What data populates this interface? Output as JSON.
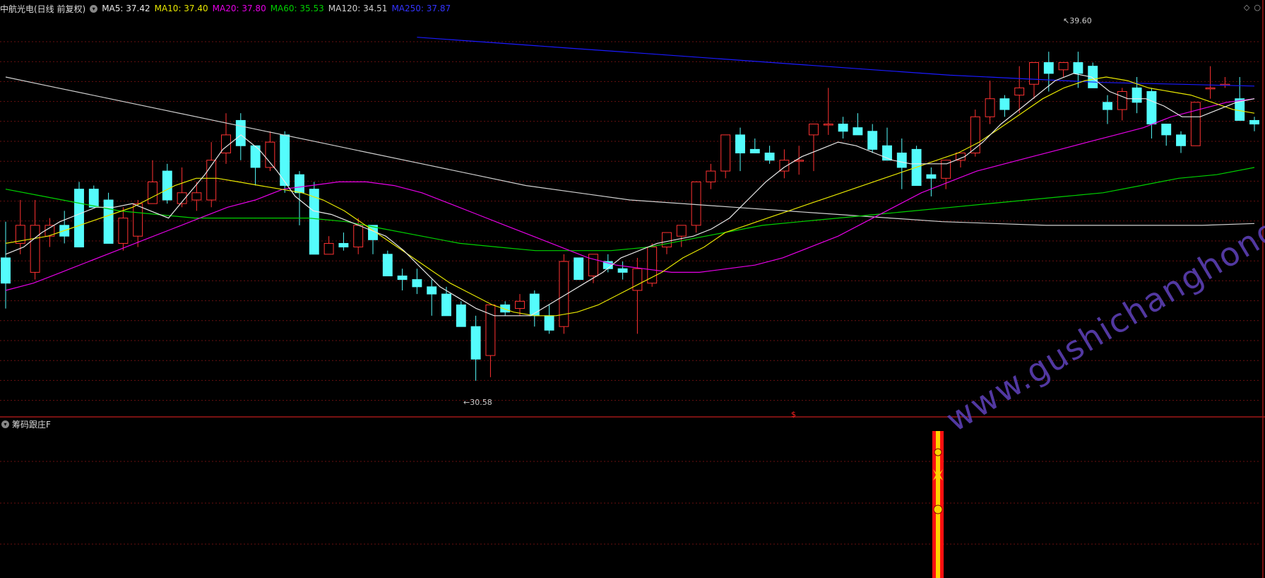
{
  "header": {
    "stock": "中航光电(日线 前复权)",
    "ma5": "MA5: 37.42",
    "ma10": "MA10: 37.40",
    "ma20": "MA20: 37.80",
    "ma60": "MA60: 35.53",
    "ma120": "MA120: 34.51",
    "ma250": "MA250: 37.87"
  },
  "colors": {
    "ma5": "#e8e8e8",
    "ma10": "#e6e600",
    "ma20": "#e600e6",
    "ma60": "#00d000",
    "ma120": "#d0d0d0",
    "ma250": "#1a1aff",
    "up": "#ff3232",
    "down": "#54fcfc"
  },
  "annotations": {
    "high": "39.60",
    "low": "30.58"
  },
  "indicator": {
    "name": "筹码跟庄F"
  },
  "marker": "$",
  "watermark": "www.gushichanghong.com",
  "topright_icons": [
    "diamond-icon",
    "circle-icon"
  ],
  "chart_data": {
    "type": "candlestick",
    "price_range": [
      29.6,
      40.6
    ],
    "candles": [
      [
        33.9,
        34.9,
        32.5,
        33.2
      ],
      [
        34.3,
        35.5,
        34.0,
        34.8
      ],
      [
        33.5,
        35.5,
        33.3,
        34.8
      ],
      [
        34.5,
        35.0,
        34.2,
        34.8
      ],
      [
        34.8,
        35.2,
        34.3,
        34.5
      ],
      [
        35.8,
        36.0,
        34.2,
        34.2
      ],
      [
        35.8,
        35.9,
        35.3,
        35.3
      ],
      [
        35.5,
        35.7,
        34.3,
        34.3
      ],
      [
        34.3,
        35.3,
        34.1,
        35.0
      ],
      [
        34.5,
        35.5,
        34.2,
        35.4
      ],
      [
        35.4,
        36.6,
        35.4,
        36.0
      ],
      [
        36.3,
        36.5,
        35.4,
        35.5
      ],
      [
        35.4,
        36.4,
        35.3,
        35.7
      ],
      [
        35.5,
        36.0,
        35.2,
        35.7
      ],
      [
        35.5,
        37.1,
        35.3,
        36.6
      ],
      [
        36.8,
        37.9,
        36.5,
        37.3
      ],
      [
        37.7,
        37.9,
        36.6,
        37.0
      ],
      [
        37.0,
        37.0,
        35.9,
        36.4
      ],
      [
        36.4,
        37.4,
        36.3,
        37.1
      ],
      [
        37.3,
        37.4,
        35.7,
        35.9
      ],
      [
        36.2,
        36.3,
        34.8,
        35.7
      ],
      [
        35.8,
        36.0,
        34.0,
        34.0
      ],
      [
        34.0,
        34.5,
        34.0,
        34.3
      ],
      [
        34.3,
        34.6,
        34.1,
        34.2
      ],
      [
        34.2,
        35.0,
        34.0,
        34.8
      ],
      [
        34.8,
        34.8,
        34.0,
        34.4
      ],
      [
        34.0,
        34.1,
        33.4,
        33.4
      ],
      [
        33.4,
        33.6,
        33.0,
        33.3
      ],
      [
        33.3,
        33.6,
        32.9,
        33.1
      ],
      [
        33.1,
        33.3,
        32.3,
        32.9
      ],
      [
        32.9,
        33.1,
        32.3,
        32.3
      ],
      [
        32.6,
        32.7,
        32.0,
        32.0
      ],
      [
        32.0,
        32.3,
        30.5,
        31.1
      ],
      [
        31.2,
        32.6,
        30.6,
        32.6
      ],
      [
        32.6,
        32.7,
        32.3,
        32.4
      ],
      [
        32.5,
        32.9,
        32.3,
        32.7
      ],
      [
        32.9,
        33.0,
        32.0,
        32.3
      ],
      [
        32.3,
        32.6,
        31.8,
        31.9
      ],
      [
        32.0,
        34.0,
        31.8,
        33.8
      ],
      [
        33.9,
        33.9,
        33.3,
        33.3
      ],
      [
        33.4,
        34.0,
        33.2,
        34.0
      ],
      [
        33.8,
        34.0,
        33.5,
        33.6
      ],
      [
        33.6,
        33.8,
        33.3,
        33.5
      ],
      [
        33.0,
        33.9,
        31.8,
        33.6
      ],
      [
        33.2,
        34.3,
        33.1,
        34.2
      ],
      [
        34.2,
        34.6,
        34.0,
        34.6
      ],
      [
        34.5,
        34.8,
        34.2,
        34.8
      ],
      [
        34.8,
        36.0,
        34.6,
        36.0
      ],
      [
        36.0,
        36.5,
        35.8,
        36.3
      ],
      [
        36.3,
        37.3,
        36.1,
        37.3
      ],
      [
        37.3,
        37.5,
        36.3,
        36.8
      ],
      [
        36.9,
        37.2,
        36.8,
        36.8
      ],
      [
        36.8,
        37.0,
        36.5,
        36.6
      ],
      [
        36.3,
        36.9,
        36.1,
        36.6
      ],
      [
        36.6,
        37.0,
        36.2,
        36.6
      ],
      [
        37.3,
        37.6,
        36.3,
        37.6
      ],
      [
        37.6,
        38.6,
        37.3,
        37.6
      ],
      [
        37.6,
        37.8,
        37.2,
        37.4
      ],
      [
        37.5,
        37.9,
        37.4,
        37.3
      ],
      [
        37.4,
        37.6,
        36.8,
        36.9
      ],
      [
        37.0,
        37.5,
        36.6,
        36.6
      ],
      [
        36.8,
        37.2,
        35.8,
        36.4
      ],
      [
        36.9,
        37.0,
        35.9,
        35.9
      ],
      [
        36.2,
        36.4,
        35.6,
        36.1
      ],
      [
        36.1,
        36.6,
        35.8,
        36.6
      ],
      [
        36.6,
        36.8,
        36.4,
        36.8
      ],
      [
        36.8,
        38.0,
        36.7,
        37.8
      ],
      [
        37.8,
        38.8,
        37.6,
        38.3
      ],
      [
        38.3,
        38.4,
        37.8,
        38.0
      ],
      [
        38.4,
        39.2,
        37.9,
        38.6
      ],
      [
        38.7,
        39.2,
        38.3,
        39.3
      ],
      [
        39.3,
        39.6,
        38.5,
        39.0
      ],
      [
        39.1,
        39.3,
        38.9,
        39.3
      ],
      [
        39.3,
        39.6,
        38.6,
        39.0
      ],
      [
        39.2,
        39.3,
        38.7,
        38.6
      ],
      [
        38.2,
        38.4,
        37.6,
        38.0
      ],
      [
        38.0,
        38.6,
        37.7,
        38.5
      ],
      [
        38.6,
        38.9,
        37.9,
        38.2
      ],
      [
        38.5,
        38.6,
        37.2,
        37.6
      ],
      [
        37.6,
        37.6,
        37.0,
        37.3
      ],
      [
        37.3,
        37.4,
        36.8,
        37.0
      ],
      [
        37.0,
        38.0,
        37.0,
        38.2
      ],
      [
        38.6,
        39.2,
        38.3,
        38.6
      ],
      [
        38.7,
        38.9,
        38.6,
        38.7
      ],
      [
        38.3,
        38.9,
        37.9,
        37.7
      ],
      [
        37.7,
        37.8,
        37.4,
        37.6
      ]
    ],
    "ma5": [
      34.0,
      34.2,
      34.6,
      34.9,
      35.1,
      35.3,
      35.3,
      35.4,
      35.2,
      35.0,
      35.6,
      36.2,
      36.9,
      37.3,
      36.9,
      36.3,
      35.6,
      35.2,
      35.1,
      34.9,
      34.7,
      34.5,
      34.1,
      33.6,
      33.1,
      32.8,
      32.5,
      32.3,
      32.3,
      32.3,
      32.6,
      32.9,
      33.2,
      33.5,
      33.9,
      34.1,
      34.3,
      34.4,
      34.5,
      34.7,
      35.0,
      35.5,
      36.0,
      36.4,
      36.7,
      36.9,
      37.1,
      37.0,
      36.8,
      36.6,
      36.5,
      36.5,
      36.5,
      36.7,
      37.1,
      37.6,
      38.0,
      38.4,
      38.8,
      39.0,
      38.9,
      38.5,
      38.3,
      38.3,
      38.1,
      37.8,
      37.8,
      38.0,
      38.2,
      38.3
    ],
    "ma10": [
      34.3,
      34.4,
      34.5,
      34.7,
      34.9,
      35.1,
      35.3,
      35.6,
      35.9,
      36.1,
      36.1,
      36.0,
      35.9,
      35.8,
      35.7,
      35.5,
      35.2,
      34.8,
      34.4,
      34.0,
      33.6,
      33.2,
      32.9,
      32.6,
      32.4,
      32.3,
      32.3,
      32.4,
      32.6,
      32.9,
      33.2,
      33.5,
      33.9,
      34.2,
      34.6,
      34.8,
      35.0,
      35.2,
      35.4,
      35.6,
      35.8,
      36.0,
      36.2,
      36.4,
      36.6,
      36.8,
      37.1,
      37.5,
      37.9,
      38.3,
      38.6,
      38.8,
      38.9,
      38.8,
      38.6,
      38.5,
      38.4,
      38.2,
      38.0,
      37.9
    ],
    "ma20": [
      33.0,
      33.2,
      33.5,
      33.8,
      34.1,
      34.4,
      34.7,
      35.0,
      35.3,
      35.5,
      35.8,
      35.9,
      36.0,
      36.0,
      35.9,
      35.7,
      35.4,
      35.1,
      34.8,
      34.5,
      34.2,
      33.9,
      33.7,
      33.6,
      33.5,
      33.5,
      33.6,
      33.7,
      33.9,
      34.2,
      34.5,
      34.9,
      35.3,
      35.7,
      36.0,
      36.3,
      36.5,
      36.7,
      36.9,
      37.1,
      37.3,
      37.5,
      37.8,
      38.0,
      38.2,
      38.3
    ],
    "ma60": [
      35.8,
      35.6,
      35.4,
      35.2,
      35.1,
      35.0,
      35.0,
      35.0,
      35.0,
      34.9,
      34.7,
      34.5,
      34.3,
      34.2,
      34.1,
      34.1,
      34.1,
      34.2,
      34.4,
      34.6,
      34.8,
      34.9,
      35.0,
      35.1,
      35.2,
      35.3,
      35.4,
      35.5,
      35.6,
      35.7,
      35.9,
      36.1,
      36.2,
      36.4
    ],
    "ma120": [
      38.9,
      38.6,
      38.3,
      38.0,
      37.7,
      37.4,
      37.1,
      36.8,
      36.5,
      36.2,
      35.9,
      35.7,
      35.5,
      35.4,
      35.3,
      35.2,
      35.1,
      35.0,
      34.9,
      34.85,
      34.8,
      34.8,
      34.8,
      34.8,
      34.85
    ],
    "ma250": [
      40.0,
      39.85,
      39.7,
      39.55,
      39.4,
      39.25,
      39.1,
      38.95,
      38.85,
      38.75,
      38.7,
      38.65
    ]
  }
}
